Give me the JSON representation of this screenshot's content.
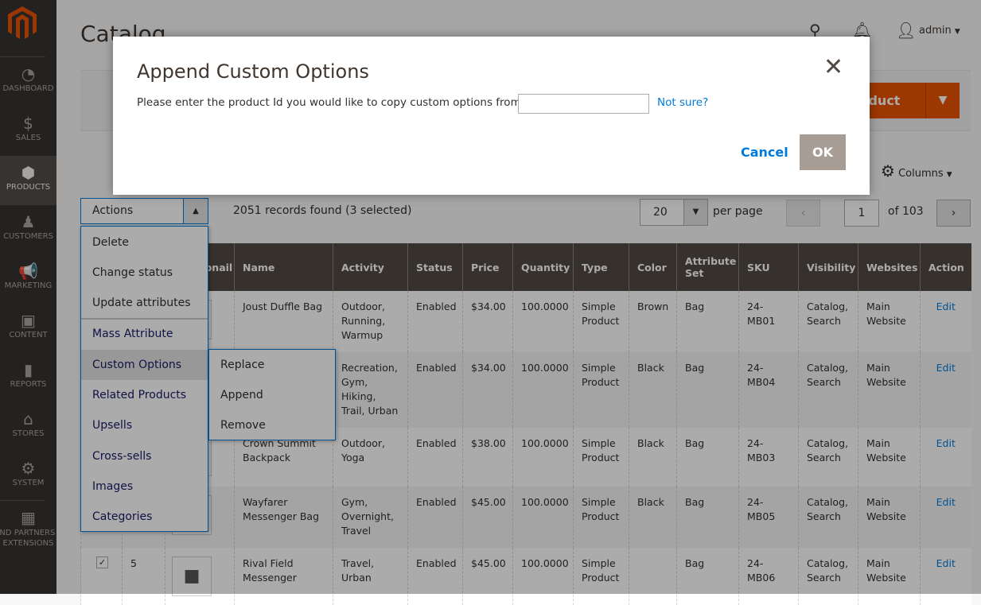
{
  "sidebar": {
    "items": [
      {
        "label": "Dashboard",
        "icon": "gauge-icon",
        "glyph": "◔"
      },
      {
        "label": "Sales",
        "icon": "dollar-icon",
        "glyph": "$"
      },
      {
        "label": "Products",
        "icon": "box-icon",
        "glyph": "⬢"
      },
      {
        "label": "Customers",
        "icon": "person-icon",
        "glyph": "♟"
      },
      {
        "label": "Marketing",
        "icon": "megaphone-icon",
        "glyph": "📢"
      },
      {
        "label": "Content",
        "icon": "layout-icon",
        "glyph": "▣"
      },
      {
        "label": "Reports",
        "icon": "bar-chart-icon",
        "glyph": "▮"
      },
      {
        "label": "Stores",
        "icon": "store-icon",
        "glyph": "⌂"
      },
      {
        "label": "System",
        "icon": "gear-icon",
        "glyph": "⚙"
      },
      {
        "label": "Find Partners & Extensions",
        "icon": "lego-block-icon",
        "glyph": "▦"
      }
    ],
    "active": "Products"
  },
  "header": {
    "title": "Catalog",
    "user": "admin"
  },
  "toolbar": {
    "add_product": "Add Product",
    "columns": "Columns"
  },
  "grid": {
    "actions_label": "Actions",
    "records": "2051 records found (3 selected)",
    "per_page_value": "20",
    "per_page_label": "per page",
    "page": "1",
    "of_pages": "of 103",
    "columns": [
      "",
      "ID",
      "Thumbnail",
      "Name",
      "Activity",
      "Status",
      "Price",
      "Quantity",
      "Type",
      "Color",
      "Attribute Set",
      "SKU",
      "Visibility",
      "Websites",
      "Action"
    ],
    "rows": [
      {
        "id": "",
        "name": "Joust Duffle Bag",
        "activity": "Outdoor, Running, Warmup",
        "status": "Enabled",
        "price": "$34.00",
        "qty": "100.0000",
        "type": "Simple Product",
        "color": "Brown",
        "set": "Bag",
        "sku": "24-MB01",
        "visibility": "Catalog, Search",
        "websites": "Main Website",
        "action": "Edit"
      },
      {
        "id": "",
        "name": "",
        "activity": "Recreation, Gym, Hiking, Trail, Urban",
        "status": "Enabled",
        "price": "$34.00",
        "qty": "100.0000",
        "type": "Simple Product",
        "color": "Black",
        "set": "Bag",
        "sku": "24-MB04",
        "visibility": "Catalog, Search",
        "websites": "Main Website",
        "action": "Edit"
      },
      {
        "id": "",
        "name": "Crown Summit Backpack",
        "activity": "Outdoor, Yoga",
        "status": "Enabled",
        "price": "$38.00",
        "qty": "100.0000",
        "type": "Simple Product",
        "color": "Black",
        "set": "Bag",
        "sku": "24-MB03",
        "visibility": "Catalog, Search",
        "websites": "Main Website",
        "action": "Edit"
      },
      {
        "id": "",
        "name": "Wayfarer Messenger Bag",
        "activity": "Gym, Overnight, Travel",
        "status": "Enabled",
        "price": "$45.00",
        "qty": "100.0000",
        "type": "Simple Product",
        "color": "Black",
        "set": "Bag",
        "sku": "24-MB05",
        "visibility": "Catalog, Search",
        "websites": "Main Website",
        "action": "Edit"
      },
      {
        "id": "5",
        "name": "Rival Field Messenger",
        "activity": "Travel, Urban",
        "status": "Enabled",
        "price": "$45.00",
        "qty": "100.0000",
        "type": "Simple Product",
        "color": "",
        "set": "Bag",
        "sku": "24-MB06",
        "visibility": "Catalog, Search",
        "websites": "Main Website",
        "action": "Edit",
        "checked": true
      }
    ]
  },
  "actions_menu": {
    "items": [
      "Delete",
      "Change status",
      "Update attributes",
      "Mass Attribute",
      "Custom Options",
      "Related Products",
      "Upsells",
      "Cross-sells",
      "Images",
      "Categories"
    ],
    "submenu": [
      "Replace",
      "Append",
      "Remove"
    ]
  },
  "modal": {
    "title": "Append Custom Options",
    "prompt": "Please enter the product Id you would like to copy custom options from:",
    "input_value": "",
    "link": "Not sure?",
    "cancel": "Cancel",
    "ok": "OK"
  },
  "colors": {
    "accent": "#eb5202",
    "link": "#007bdb",
    "sidebar": "#373330",
    "table_header": "#514943"
  }
}
